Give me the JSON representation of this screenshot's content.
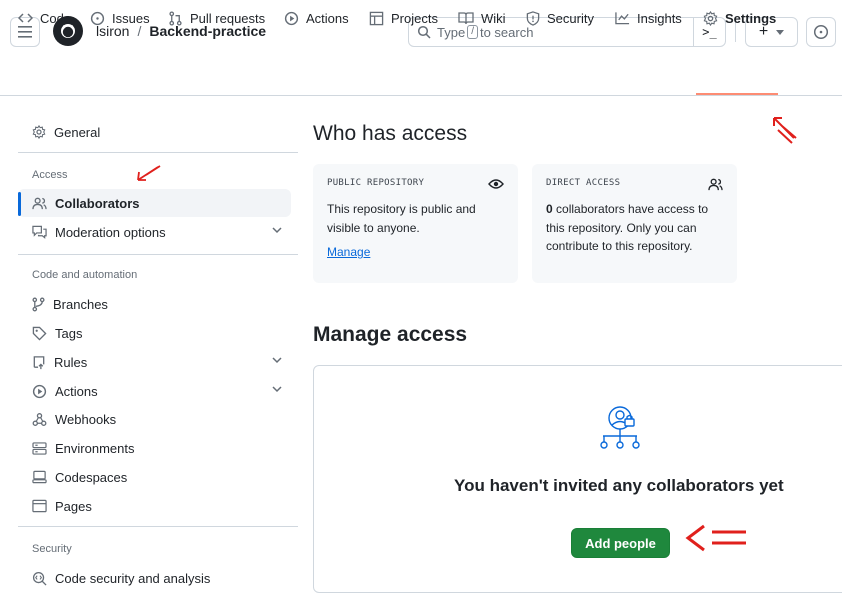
{
  "header": {
    "owner": "lsiron",
    "separator": "/",
    "repo": "Backend-practice",
    "search_prefix": "Type",
    "search_key": "/",
    "search_suffix": "to search",
    "command_glyph": ">_"
  },
  "repo_nav": [
    {
      "label": "Code",
      "icon": "code-icon"
    },
    {
      "label": "Issues",
      "icon": "issue-icon"
    },
    {
      "label": "Pull requests",
      "icon": "pull-request-icon"
    },
    {
      "label": "Actions",
      "icon": "play-icon"
    },
    {
      "label": "Projects",
      "icon": "table-icon"
    },
    {
      "label": "Wiki",
      "icon": "book-icon"
    },
    {
      "label": "Security",
      "icon": "shield-icon"
    },
    {
      "label": "Insights",
      "icon": "graph-icon"
    },
    {
      "label": "Settings",
      "icon": "gear-icon",
      "active": true
    }
  ],
  "sidebar": {
    "general": "General",
    "access_heading": "Access",
    "collaborators": "Collaborators",
    "moderation": "Moderation options",
    "code_heading": "Code and automation",
    "branches": "Branches",
    "tags": "Tags",
    "rules": "Rules",
    "actions": "Actions",
    "webhooks": "Webhooks",
    "environments": "Environments",
    "codespaces": "Codespaces",
    "pages": "Pages",
    "security_heading": "Security",
    "code_security": "Code security and analysis"
  },
  "main": {
    "who_title": "Who has access",
    "public_card": {
      "label": "PUBLIC REPOSITORY",
      "text": "This repository is public and visible to anyone.",
      "link": "Manage"
    },
    "direct_card": {
      "label": "DIRECT ACCESS",
      "count": "0",
      "text": " collaborators have access to this repository. Only you can contribute to this repository."
    },
    "manage_title": "Manage access",
    "empty_text": "You haven't invited any collaborators yet",
    "add_button": "Add people"
  },
  "colors": {
    "accent_blue": "#0969da",
    "success_green": "#1f883d",
    "nav_underline": "#fd8c73",
    "annotation_red": "#e0201c"
  }
}
